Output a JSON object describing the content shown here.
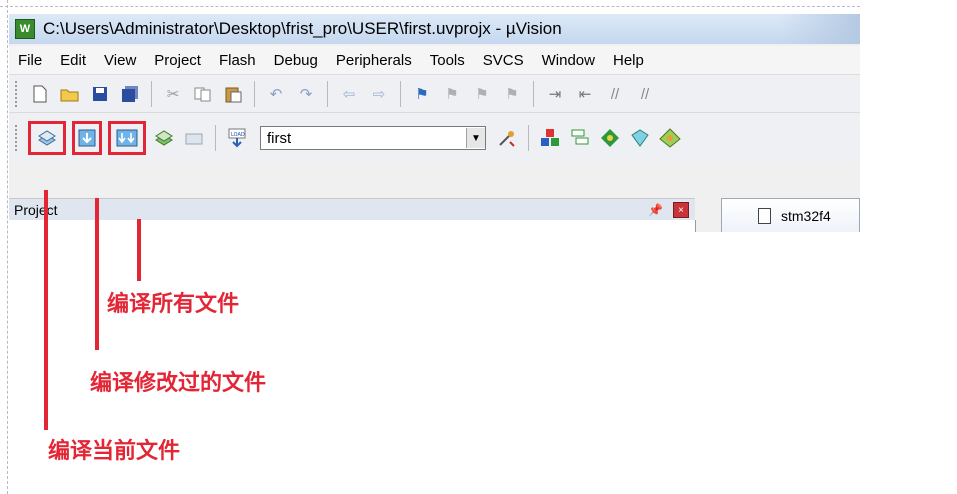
{
  "window": {
    "title": "C:\\Users\\Administrator\\Desktop\\frist_pro\\USER\\first.uvprojx - µVision",
    "app_icon": "uvision-icon"
  },
  "menu": {
    "items": [
      "File",
      "Edit",
      "View",
      "Project",
      "Flash",
      "Debug",
      "Peripherals",
      "Tools",
      "SVCS",
      "Window",
      "Help"
    ]
  },
  "toolbar": {
    "target_value": "first"
  },
  "project_panel": {
    "title": "Project",
    "pin_glyph": "ᵖ",
    "close_glyph": "×"
  },
  "editor": {
    "tab_label": "stm32f4"
  },
  "annotations": {
    "build_all": "编译所有文件",
    "build_changed": "编译修改过的文件",
    "build_current": "编译当前文件"
  },
  "colors": {
    "annotation_red": "#e32636"
  }
}
